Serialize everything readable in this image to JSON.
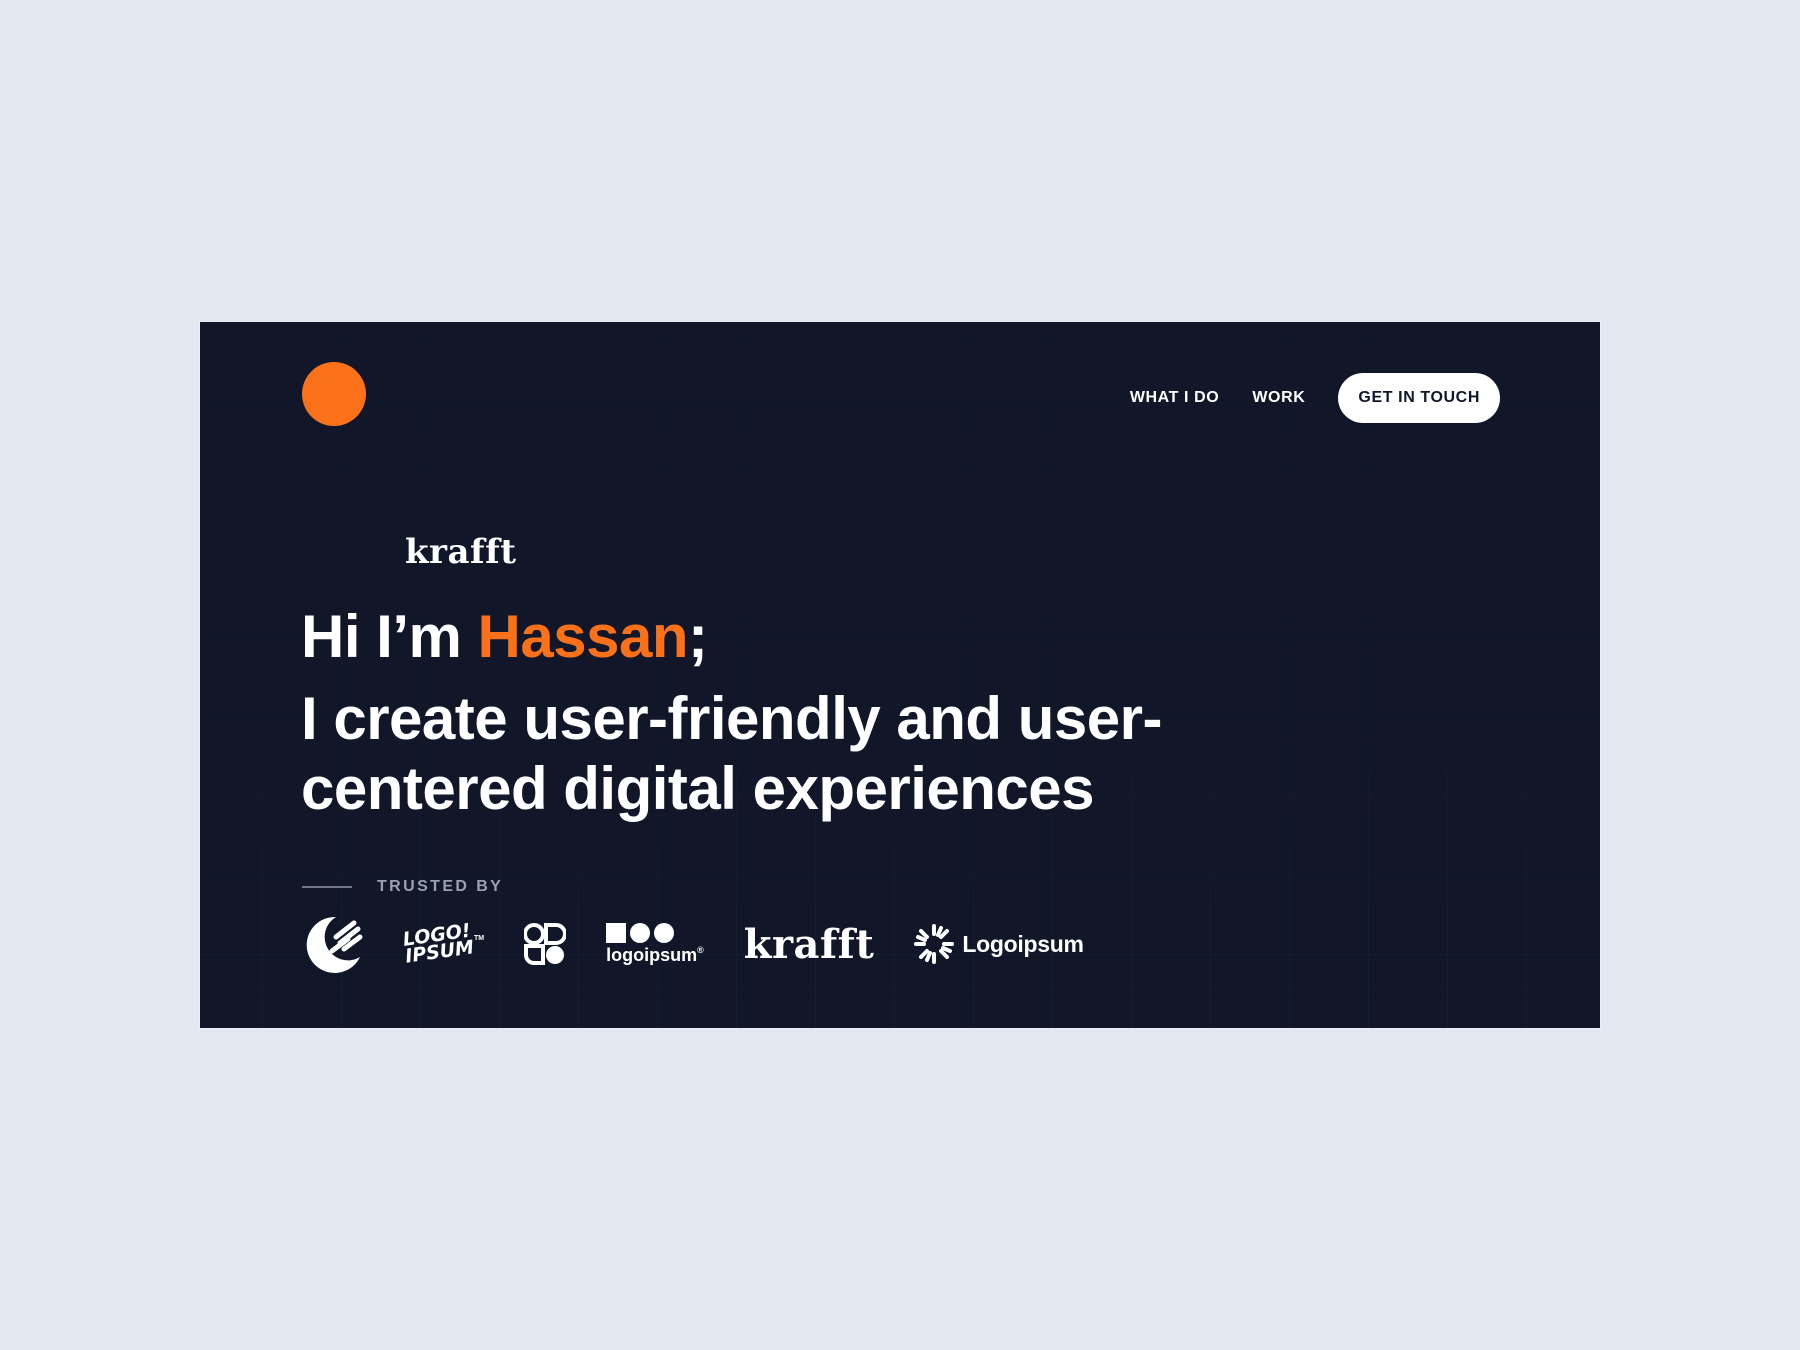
{
  "header": {
    "nav": {
      "what_i_do": "WHAT I DO",
      "work": "WORK",
      "get_in_touch": "GET IN TOUCH"
    }
  },
  "hero": {
    "floating_brand": "krafft",
    "greeting_prefix": "Hi I’m ",
    "name": "Hassan",
    "greeting_suffix": ";",
    "tagline": "I create user-friendly and user-centered digital experiences"
  },
  "trusted": {
    "label": "TRUSTED BY"
  },
  "client_logos": [
    {
      "icon": "crescent-fork-logo-icon"
    },
    {
      "text_line1": "LOGO!",
      "text_line2": "IPSUM",
      "tm": "TM"
    },
    {
      "icon": "geometric-shapes-logo-icon"
    },
    {
      "text": "logoipsum",
      "reg": "®"
    },
    {
      "text": "krafft"
    },
    {
      "icon": "sunburst-logo-icon",
      "text": "Logoipsum"
    }
  ],
  "colors": {
    "background": "#e4e8f0",
    "card": "#111729",
    "accent": "#fb7119",
    "text": "#ffffff",
    "muted": "#9aa0ad"
  }
}
